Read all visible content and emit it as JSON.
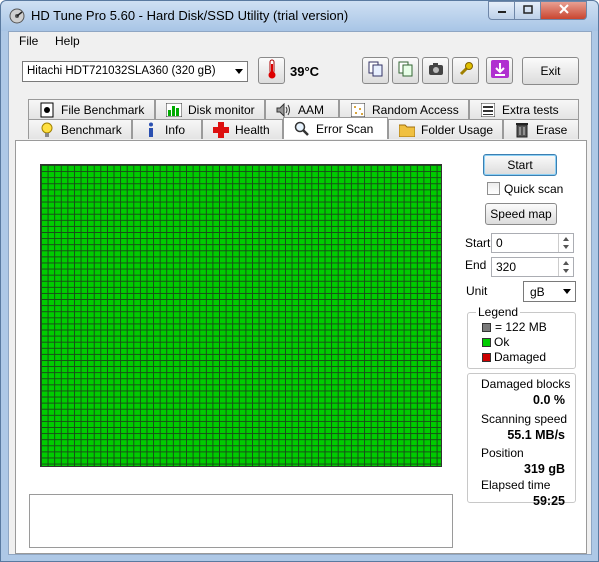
{
  "window": {
    "title": "HD Tune Pro 5.60 - Hard Disk/SSD Utility (trial version)"
  },
  "menu": {
    "file": "File",
    "help": "Help"
  },
  "toolbar": {
    "drive": "Hitachi HDT721032SLA360 (320 gB)",
    "temperature": "39",
    "temperature_unit": "°C",
    "exit_label": "Exit"
  },
  "tabs": {
    "row1": [
      {
        "label": "File Benchmark",
        "icon": "file-benchmark-icon"
      },
      {
        "label": "Disk monitor",
        "icon": "disk-monitor-icon"
      },
      {
        "label": "AAM",
        "icon": "speaker-icon"
      },
      {
        "label": "Random Access",
        "icon": "random-access-icon"
      },
      {
        "label": "Extra tests",
        "icon": "extra-tests-icon"
      }
    ],
    "row2": [
      {
        "label": "Benchmark",
        "icon": "lightbulb-icon"
      },
      {
        "label": "Info",
        "icon": "info-icon"
      },
      {
        "label": "Health",
        "icon": "health-cross-icon"
      },
      {
        "label": "Error Scan",
        "icon": "magnifier-icon"
      },
      {
        "label": "Folder Usage",
        "icon": "folder-icon"
      },
      {
        "label": "Erase",
        "icon": "trash-icon"
      }
    ],
    "active": "Error Scan"
  },
  "scan": {
    "start_button": "Start",
    "quick_scan_label": "Quick scan",
    "quick_scan_checked": false,
    "speed_map_button": "Speed map",
    "start_label": "Start",
    "start_value": "0",
    "end_label": "End",
    "end_value": "320",
    "unit_label": "Unit",
    "unit_value": "gB"
  },
  "legend": {
    "title": "Legend",
    "block_size": "= 122 MB",
    "ok": "Ok",
    "damaged": "Damaged",
    "colors": {
      "block": "#7a7a7a",
      "ok": "#00cc00",
      "damaged": "#cc0000"
    }
  },
  "stats": {
    "damaged_blocks_label": "Damaged blocks",
    "damaged_blocks_value": "0.0 %",
    "scanning_speed_label": "Scanning speed",
    "scanning_speed_value": "55.1 MB/s",
    "position_label": "Position",
    "position_value": "319 gB",
    "elapsed_time_label": "Elapsed time",
    "elapsed_time_value": "59:25"
  },
  "scan_map": {
    "status": "all blocks ok",
    "ok_color": "#00cc00"
  }
}
